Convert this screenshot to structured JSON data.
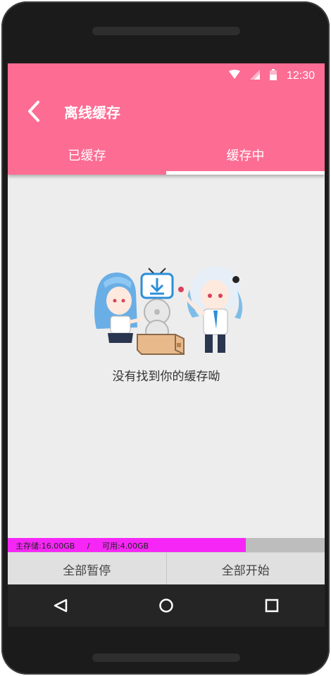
{
  "status": {
    "time": "12:30",
    "wifi_icon": "wifi-icon",
    "signal_icon": "signal-icon",
    "battery_icon": "battery-icon"
  },
  "toolbar": {
    "title": "离线缓存",
    "back_icon": "back-arrow-icon"
  },
  "tabs": [
    {
      "label": "已缓存",
      "active": false
    },
    {
      "label": "缓存中",
      "active": true
    }
  ],
  "empty_state": {
    "message": "没有找到你的缓存呦",
    "illustration": "empty-cache-illustration"
  },
  "storage": {
    "text": "主存储:16.00GB     /     可用:4.00GB",
    "used_fraction": 0.75,
    "fill_color": "#f627f6",
    "track_color": "#bdbdbd"
  },
  "actions": {
    "pause_all": "全部暂停",
    "start_all": "全部开始"
  },
  "colors": {
    "accent": "#fd6c93",
    "screen_bg": "#ededed"
  },
  "navbar": {
    "back_icon": "nav-back-icon",
    "home_icon": "nav-home-icon",
    "recents_icon": "nav-recents-icon"
  }
}
